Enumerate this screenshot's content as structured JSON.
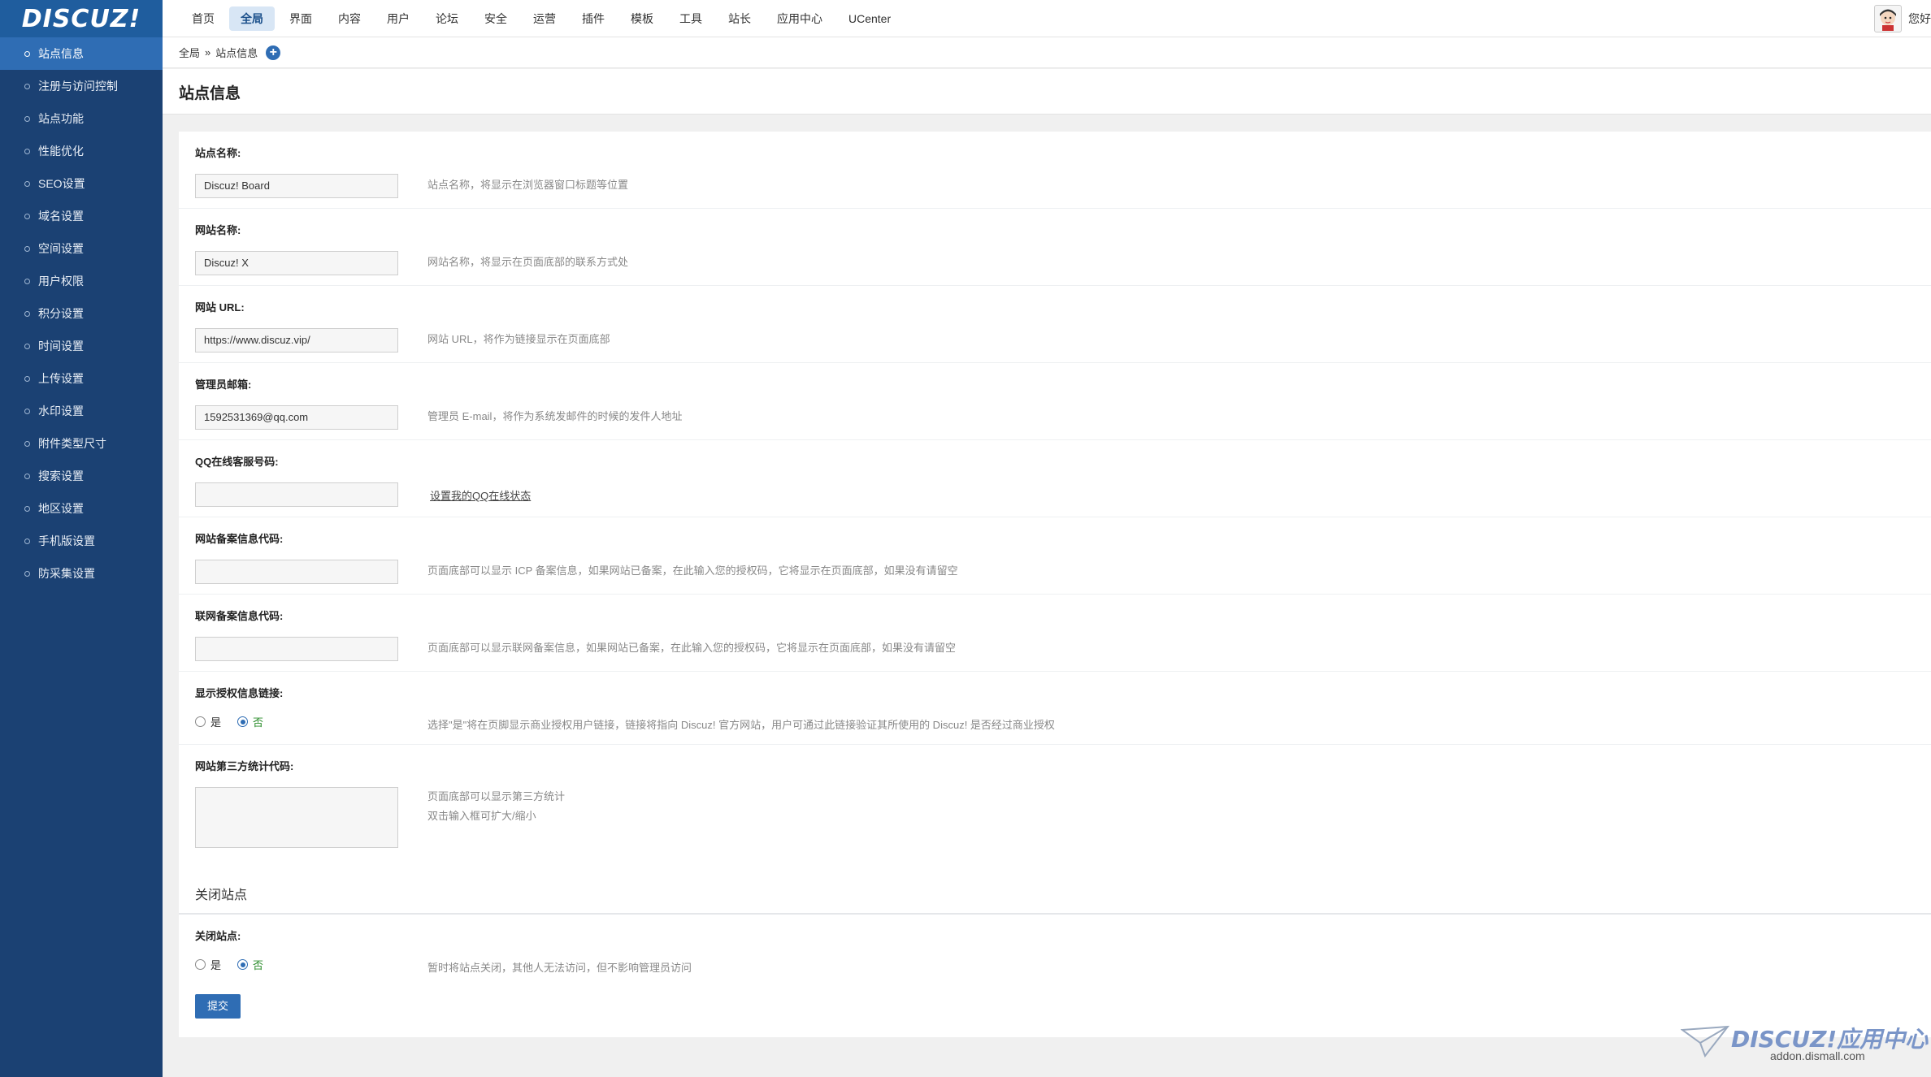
{
  "logo": {
    "text": "DISCUZ!"
  },
  "nav": {
    "items": [
      "首页",
      "全局",
      "界面",
      "内容",
      "用户",
      "论坛",
      "安全",
      "运营",
      "插件",
      "模板",
      "工具",
      "站长",
      "应用中心",
      "UCenter"
    ],
    "active_index": 1
  },
  "user": {
    "text": "您好"
  },
  "sidebar": {
    "items": [
      "站点信息",
      "注册与访问控制",
      "站点功能",
      "性能优化",
      "SEO设置",
      "域名设置",
      "空间设置",
      "用户权限",
      "积分设置",
      "时间设置",
      "上传设置",
      "水印设置",
      "附件类型尺寸",
      "搜索设置",
      "地区设置",
      "手机版设置",
      "防采集设置"
    ],
    "active_index": 0
  },
  "breadcrumb": {
    "root": "全局",
    "sep": "»",
    "current": "站点信息"
  },
  "page_title": "站点信息",
  "form": {
    "site_name": {
      "label": "站点名称:",
      "value": "Discuz! Board",
      "desc": "站点名称，将显示在浏览器窗口标题等位置"
    },
    "web_name": {
      "label": "网站名称:",
      "value": "Discuz! X",
      "desc": "网站名称，将显示在页面底部的联系方式处"
    },
    "site_url": {
      "label": "网站 URL:",
      "value": "https://www.discuz.vip/",
      "desc": "网站 URL，将作为链接显示在页面底部"
    },
    "admin_email": {
      "label": "管理员邮箱:",
      "value": "1592531369@qq.com",
      "desc": "管理员 E-mail，将作为系统发邮件的时候的发件人地址"
    },
    "qq": {
      "label": "QQ在线客服号码:",
      "value": "",
      "link": "设置我的QQ在线状态"
    },
    "icp": {
      "label": "网站备案信息代码:",
      "value": "",
      "desc": "页面底部可以显示 ICP 备案信息，如果网站已备案，在此输入您的授权码，它将显示在页面底部，如果没有请留空"
    },
    "mps": {
      "label": "联网备案信息代码:",
      "value": "",
      "desc": "页面底部可以显示联网备案信息，如果网站已备案，在此输入您的授权码，它将显示在页面底部，如果没有请留空"
    },
    "license_link": {
      "label": "显示授权信息链接:",
      "yes": "是",
      "no": "否",
      "selected": "no",
      "desc": "选择\"是\"将在页脚显示商业授权用户链接，链接将指向 Discuz! 官方网站，用户可通过此链接验证其所使用的 Discuz! 是否经过商业授权"
    },
    "stat_code": {
      "label": "网站第三方统计代码:",
      "desc_line1": "页面底部可以显示第三方统计",
      "desc_line2": "双击输入框可扩大/缩小"
    },
    "close_section": {
      "title": "关闭站点"
    },
    "close_site": {
      "label": "关闭站点:",
      "yes": "是",
      "no": "否",
      "selected": "no",
      "desc": "暂时将站点关闭，其他人无法访问，但不影响管理员访问"
    },
    "submit_label": "提交"
  },
  "watermark": {
    "brand": "DISCUZ!应用中心",
    "url": "addon.dismall.com"
  }
}
